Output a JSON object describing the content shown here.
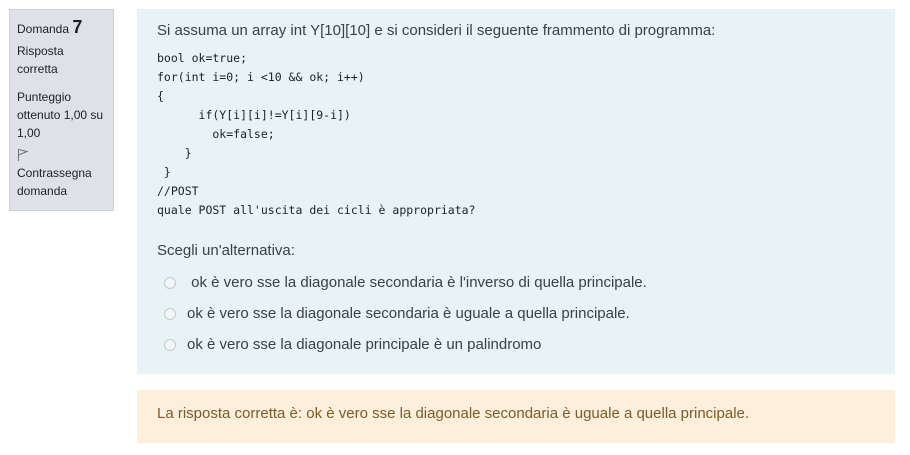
{
  "info": {
    "question_word": "Domanda",
    "question_number": "7",
    "state": "Risposta corretta",
    "grade": "Punteggio ottenuto 1,00 su 1,00",
    "flag_label": "Contrassegna domanda",
    "flag_icon": "flag-icon"
  },
  "question": {
    "text": "Si assuma un array int Y[10][10] e si consideri il seguente frammento di programma:",
    "code": "bool ok=true;\nfor(int i=0; i <10 && ok; i++)\n{\n      if(Y[i][i]!=Y[i][9-i])\n        ok=false;\n    }\n }\n//POST\nquale POST all'uscita dei cicli è appropriata?",
    "prompt": "Scegli un'alternativa:",
    "options": [
      " ok è vero sse la diagonale secondaria è l'inverso di quella principale.",
      "ok è vero sse la diagonale secondaria è uguale a quella principale.",
      "ok è vero sse la diagonale principale è un palindromo"
    ]
  },
  "feedback": {
    "text": "La risposta corretta è: ok è vero sse la diagonale secondaria è uguale a quella principale."
  },
  "colors": {
    "formulation_bg": "#e7f3f5",
    "info_bg": "#dee2e6",
    "feedback_bg": "#fcefdc",
    "feedback_text": "#7d5a29"
  }
}
